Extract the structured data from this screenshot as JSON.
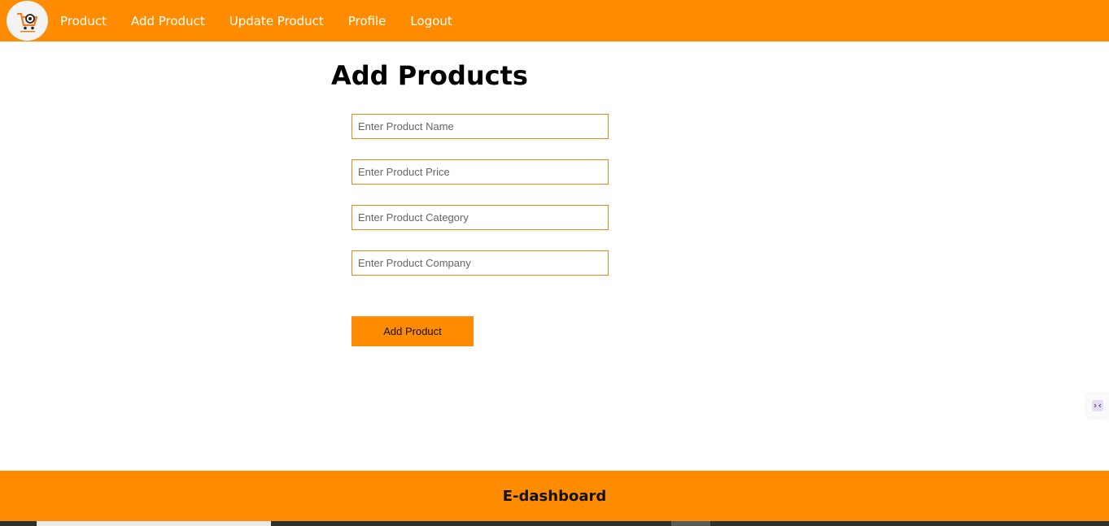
{
  "nav": {
    "logo_icon": "shopping-cart-logo-icon",
    "links": [
      {
        "label": "Product"
      },
      {
        "label": "Add Product"
      },
      {
        "label": "Update Product"
      },
      {
        "label": "Profile"
      },
      {
        "label": "Logout"
      }
    ]
  },
  "main": {
    "title": "Add Products",
    "fields": {
      "name_placeholder": "Enter Product Name",
      "price_placeholder": "Enter Product Price",
      "category_placeholder": "Enter Product Category",
      "company_placeholder": "Enter Product Company"
    },
    "submit_label": "Add Product"
  },
  "footer": {
    "title": "E-dashboard"
  },
  "colors": {
    "accent": "#ff8c00",
    "field_border": "#e08a1e",
    "background": "#ffffff"
  }
}
